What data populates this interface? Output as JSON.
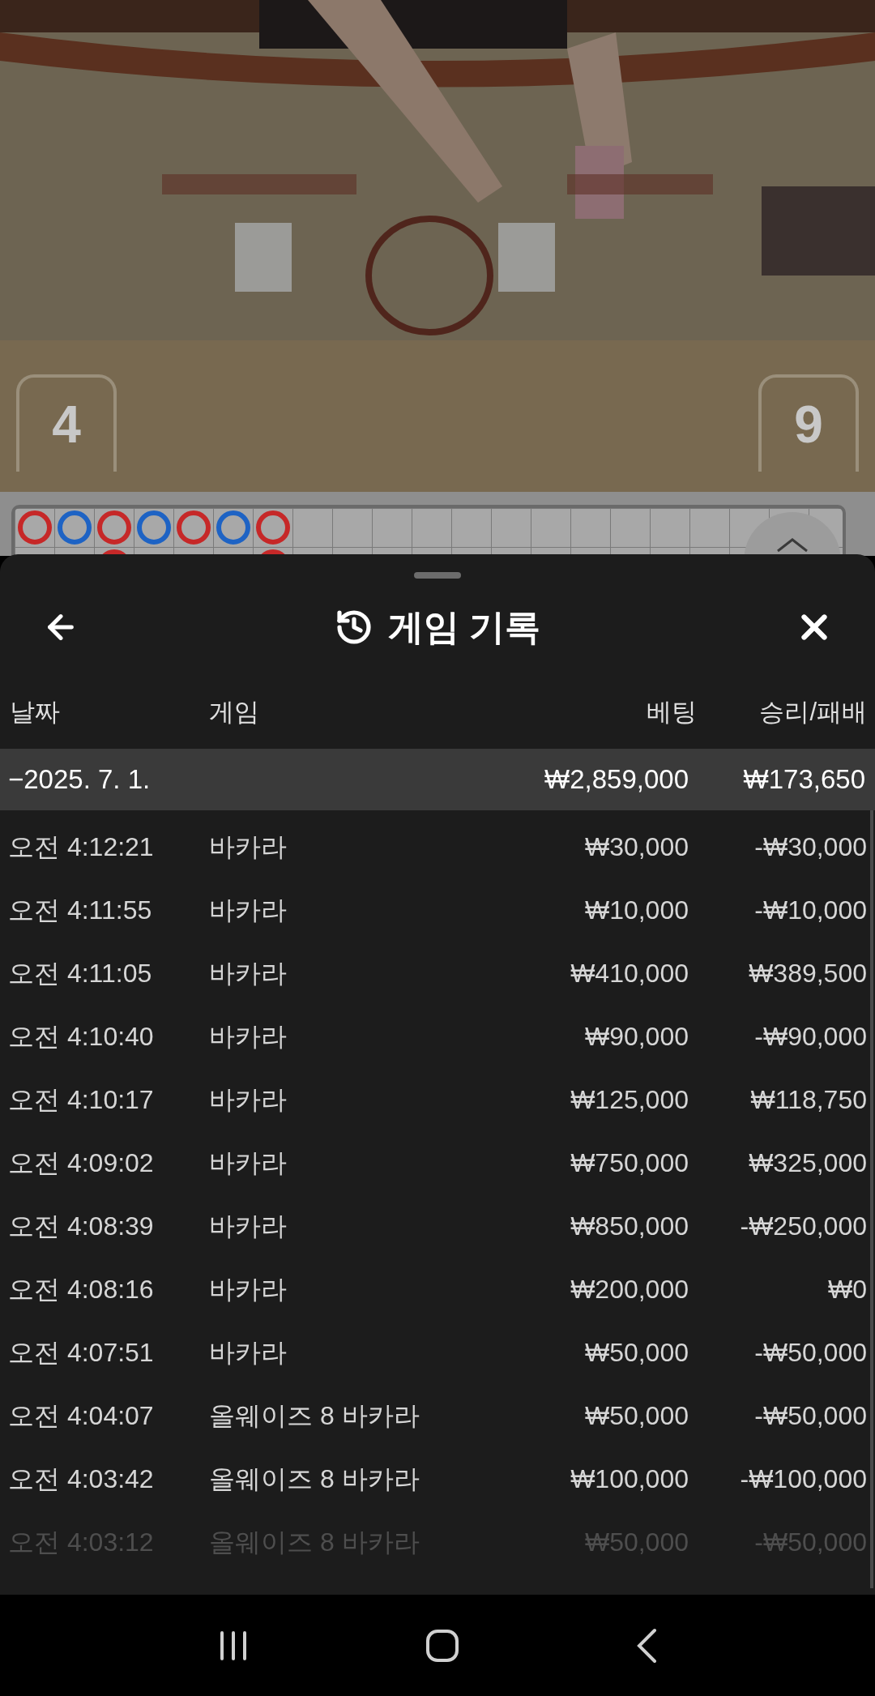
{
  "video": {
    "scores": [
      "4",
      "9"
    ]
  },
  "roadmap": {
    "columns": [
      {
        "marks": [
          {
            "color": "#c62828"
          }
        ]
      },
      {
        "marks": [
          {
            "color": "#1e63c4"
          }
        ]
      },
      {
        "marks": [
          {
            "color": "#c62828"
          },
          {
            "color": "#c62828"
          }
        ]
      },
      {
        "marks": [
          {
            "color": "#1e63c4"
          }
        ]
      },
      {
        "marks": [
          {
            "color": "#c62828"
          }
        ]
      },
      {
        "marks": [
          {
            "color": "#1e63c4"
          }
        ]
      },
      {
        "marks": [
          {
            "color": "#c62828"
          },
          {
            "color": "#c62828"
          }
        ]
      }
    ]
  },
  "sheet": {
    "title": "게임 기록",
    "columns": [
      "날짜",
      "게임",
      "베팅",
      "승리/패배"
    ],
    "summary": {
      "date": "−2025. 7. 1.",
      "bet": "₩2,859,000",
      "result": "₩173,650"
    },
    "rows": [
      {
        "time": "오전 4:12:21",
        "game": "바카라",
        "bet": "₩30,000",
        "result": "-₩30,000",
        "faded": false
      },
      {
        "time": "오전 4:11:55",
        "game": "바카라",
        "bet": "₩10,000",
        "result": "-₩10,000",
        "faded": false
      },
      {
        "time": "오전 4:11:05",
        "game": "바카라",
        "bet": "₩410,000",
        "result": "₩389,500",
        "faded": false
      },
      {
        "time": "오전 4:10:40",
        "game": "바카라",
        "bet": "₩90,000",
        "result": "-₩90,000",
        "faded": false
      },
      {
        "time": "오전 4:10:17",
        "game": "바카라",
        "bet": "₩125,000",
        "result": "₩118,750",
        "faded": false
      },
      {
        "time": "오전 4:09:02",
        "game": "바카라",
        "bet": "₩750,000",
        "result": "₩325,000",
        "faded": false
      },
      {
        "time": "오전 4:08:39",
        "game": "바카라",
        "bet": "₩850,000",
        "result": "-₩250,000",
        "faded": false
      },
      {
        "time": "오전 4:08:16",
        "game": "바카라",
        "bet": "₩200,000",
        "result": "₩0",
        "faded": false
      },
      {
        "time": "오전 4:07:51",
        "game": "바카라",
        "bet": "₩50,000",
        "result": "-₩50,000",
        "faded": false
      },
      {
        "time": "오전 4:04:07",
        "game": "올웨이즈 8 바카라",
        "bet": "₩50,000",
        "result": "-₩50,000",
        "faded": false
      },
      {
        "time": "오전 4:03:42",
        "game": "올웨이즈 8 바카라",
        "bet": "₩100,000",
        "result": "-₩100,000",
        "faded": false
      },
      {
        "time": "오전 4:03:12",
        "game": "올웨이즈 8 바카라",
        "bet": "₩50,000",
        "result": "-₩50,000",
        "faded": true
      }
    ]
  }
}
